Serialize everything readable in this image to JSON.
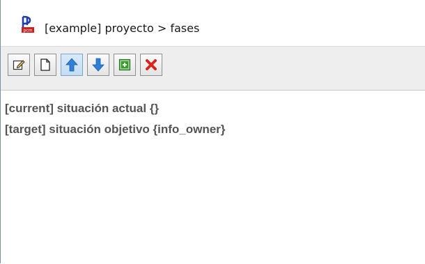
{
  "window": {
    "title": "[example] proyecto > fases",
    "app_icon": "pcm-logo-icon",
    "app_icon_label": "pcm"
  },
  "toolbar": {
    "buttons": [
      {
        "icon": "edit-icon",
        "pressed": false
      },
      {
        "icon": "new-document-icon",
        "pressed": false
      },
      {
        "icon": "arrow-up-icon",
        "pressed": true
      },
      {
        "icon": "arrow-down-icon",
        "pressed": false
      },
      {
        "icon": "add-green-icon",
        "pressed": false
      },
      {
        "icon": "delete-x-icon",
        "pressed": false
      }
    ]
  },
  "content": {
    "items": [
      {
        "text": "[current] situación actual {}"
      },
      {
        "text": "[target] situación objetivo {info_owner}"
      }
    ]
  },
  "colors": {
    "text": "#555555",
    "arrow_blue": "#2f7fd6",
    "delete_red": "#d9261c",
    "add_green": "#3f9a2f",
    "logo_blue": "#1f3fa8",
    "logo_red": "#cc2020"
  }
}
